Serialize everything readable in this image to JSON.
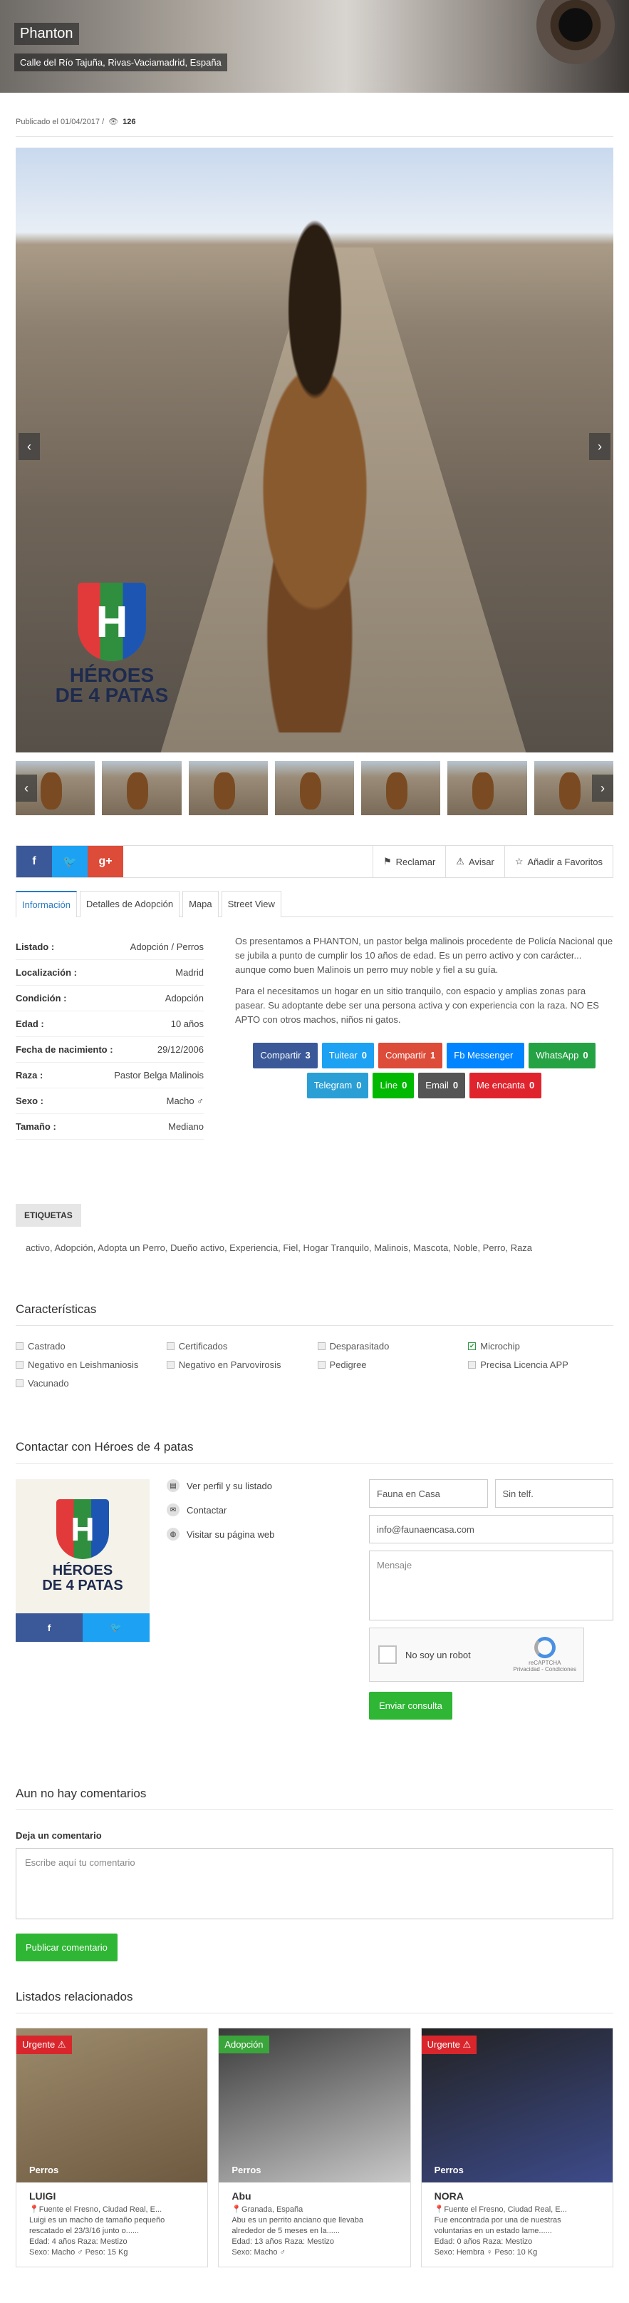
{
  "listing": {
    "title": "Phanton",
    "address": "Calle del Río Tajuña, Rivas-Vaciamadrid, España",
    "published": "Publicado el 01/04/2017 /",
    "views": "126"
  },
  "gallery": {
    "logo_line1": "HÉROES",
    "logo_line2": "DE 4 PATAS",
    "logo_letter": "H"
  },
  "actions": {
    "report": "Reclamar",
    "notify": "Avisar",
    "favorite": "Añadir a Favoritos"
  },
  "tabs": [
    "Información",
    "Detalles de Adopción",
    "Mapa",
    "Street View"
  ],
  "specs": [
    {
      "label": "Listado :",
      "value": "Adopción / Perros"
    },
    {
      "label": "Localización :",
      "value": "Madrid"
    },
    {
      "label": "Condición :",
      "value": "Adopción"
    },
    {
      "label": "Edad :",
      "value": "10 años"
    },
    {
      "label": "Fecha de nacimiento :",
      "value": "29/12/2006"
    },
    {
      "label": "Raza :",
      "value": "Pastor Belga Malinois"
    },
    {
      "label": "Sexo :",
      "value": "Macho ♂"
    },
    {
      "label": "Tamaño :",
      "value": "Mediano"
    }
  ],
  "description": {
    "p1": "Os presentamos a PHANTON, un pastor belga malinois procedente de Policía Nacional que se jubila a punto de cumplir los 10 años de edad. Es un perro activo y con carácter... aunque como buen Malinois un perro muy noble y fiel a su guía.",
    "p2": "Para el necesitamos un hogar en un sitio tranquilo, con espacio y amplias zonas para pasear. Su adoptante debe ser una persona activa y con experiencia con la raza. NO ES APTO con otros machos, niños ni gatos."
  },
  "share_buttons": [
    {
      "label": "Compartir",
      "count": "3",
      "color": "#3b5998"
    },
    {
      "label": "Tuitear",
      "count": "0",
      "color": "#1da1f2"
    },
    {
      "label": "Compartir",
      "count": "1",
      "color": "#dd4b39"
    },
    {
      "label": "Fb Messenger",
      "count": "",
      "color": "#0084ff"
    },
    {
      "label": "WhatsApp",
      "count": "0",
      "color": "#25a244"
    },
    {
      "label": "Telegram",
      "count": "0",
      "color": "#2a9fd6"
    },
    {
      "label": "Line",
      "count": "0",
      "color": "#00b900"
    },
    {
      "label": "Email",
      "count": "0",
      "color": "#555555"
    },
    {
      "label": "Me encanta",
      "count": "0",
      "color": "#e0242e"
    }
  ],
  "tags": {
    "heading": "ETIQUETAS",
    "list": "activo, Adopción, Adopta un Perro, Dueño activo, Experiencia, Fiel, Hogar Tranquilo, Malinois, Mascota, Noble, Perro, Raza"
  },
  "features": {
    "heading": "Características",
    "items": [
      {
        "label": "Castrado",
        "checked": false
      },
      {
        "label": "Certificados",
        "checked": false
      },
      {
        "label": "Desparasitado",
        "checked": false
      },
      {
        "label": "Microchip",
        "checked": true
      },
      {
        "label": "Negativo en Leishmaniosis",
        "checked": false
      },
      {
        "label": "Negativo en Parvovirosis",
        "checked": false
      },
      {
        "label": "Pedigree",
        "checked": false
      },
      {
        "label": "Precisa Licencia APP",
        "checked": false
      },
      {
        "label": "Vacunado",
        "checked": false
      }
    ]
  },
  "contact": {
    "heading": "Contactar con Héroes de 4 patas",
    "links": [
      "Ver perfil y su listado",
      "Contactar",
      "Visitar su página web"
    ],
    "name_value": "Fauna en Casa",
    "phone_value": "Sin telf.",
    "email_value": "info@faunaencasa.com",
    "message_placeholder": "Mensaje",
    "captcha_label": "No soy un robot",
    "captcha_brand": "reCAPTCHA",
    "captcha_links": "Privacidad - Condiciones",
    "submit": "Enviar consulta"
  },
  "comments": {
    "heading": "Aun no hay comentarios",
    "label": "Deja un comentario",
    "placeholder": "Escribe aquí tu comentario",
    "submit": "Publicar comentario"
  },
  "related": {
    "heading": "Listados relacionados",
    "cards": [
      {
        "badge": "Urgente ⚠",
        "badge_color": "#d9262c",
        "category": "Perros",
        "name": "LUIGI",
        "location": "Fuente el Fresno, Ciudad Real, E...",
        "text": "Luigi es un macho de tamaño pequeño rescatado el 23/3/16 junto o......",
        "age": "Edad: 4 años Raza: Mestizo",
        "sex": "Sexo: Macho ♂  Peso: 15 Kg"
      },
      {
        "badge": "Adopción",
        "badge_color": "#3aa53a",
        "category": "Perros",
        "name": "Abu",
        "location": "Granada, España",
        "text": "Abu es un perrito anciano que llevaba alrededor de 5 meses en la......",
        "age": "Edad: 13 años Raza: Mestizo",
        "sex": "Sexo: Macho ♂"
      },
      {
        "badge": "Urgente ⚠",
        "badge_color": "#d9262c",
        "category": "Perros",
        "name": "NORA",
        "location": "Fuente el Fresno, Ciudad Real, E...",
        "text": "Fue encontrada por una de nuestras voluntarias en un estado lame......",
        "age": "Edad: 0 años Raza: Mestizo",
        "sex": "Sexo: Hembra ♀  Peso: 10 Kg"
      }
    ]
  }
}
